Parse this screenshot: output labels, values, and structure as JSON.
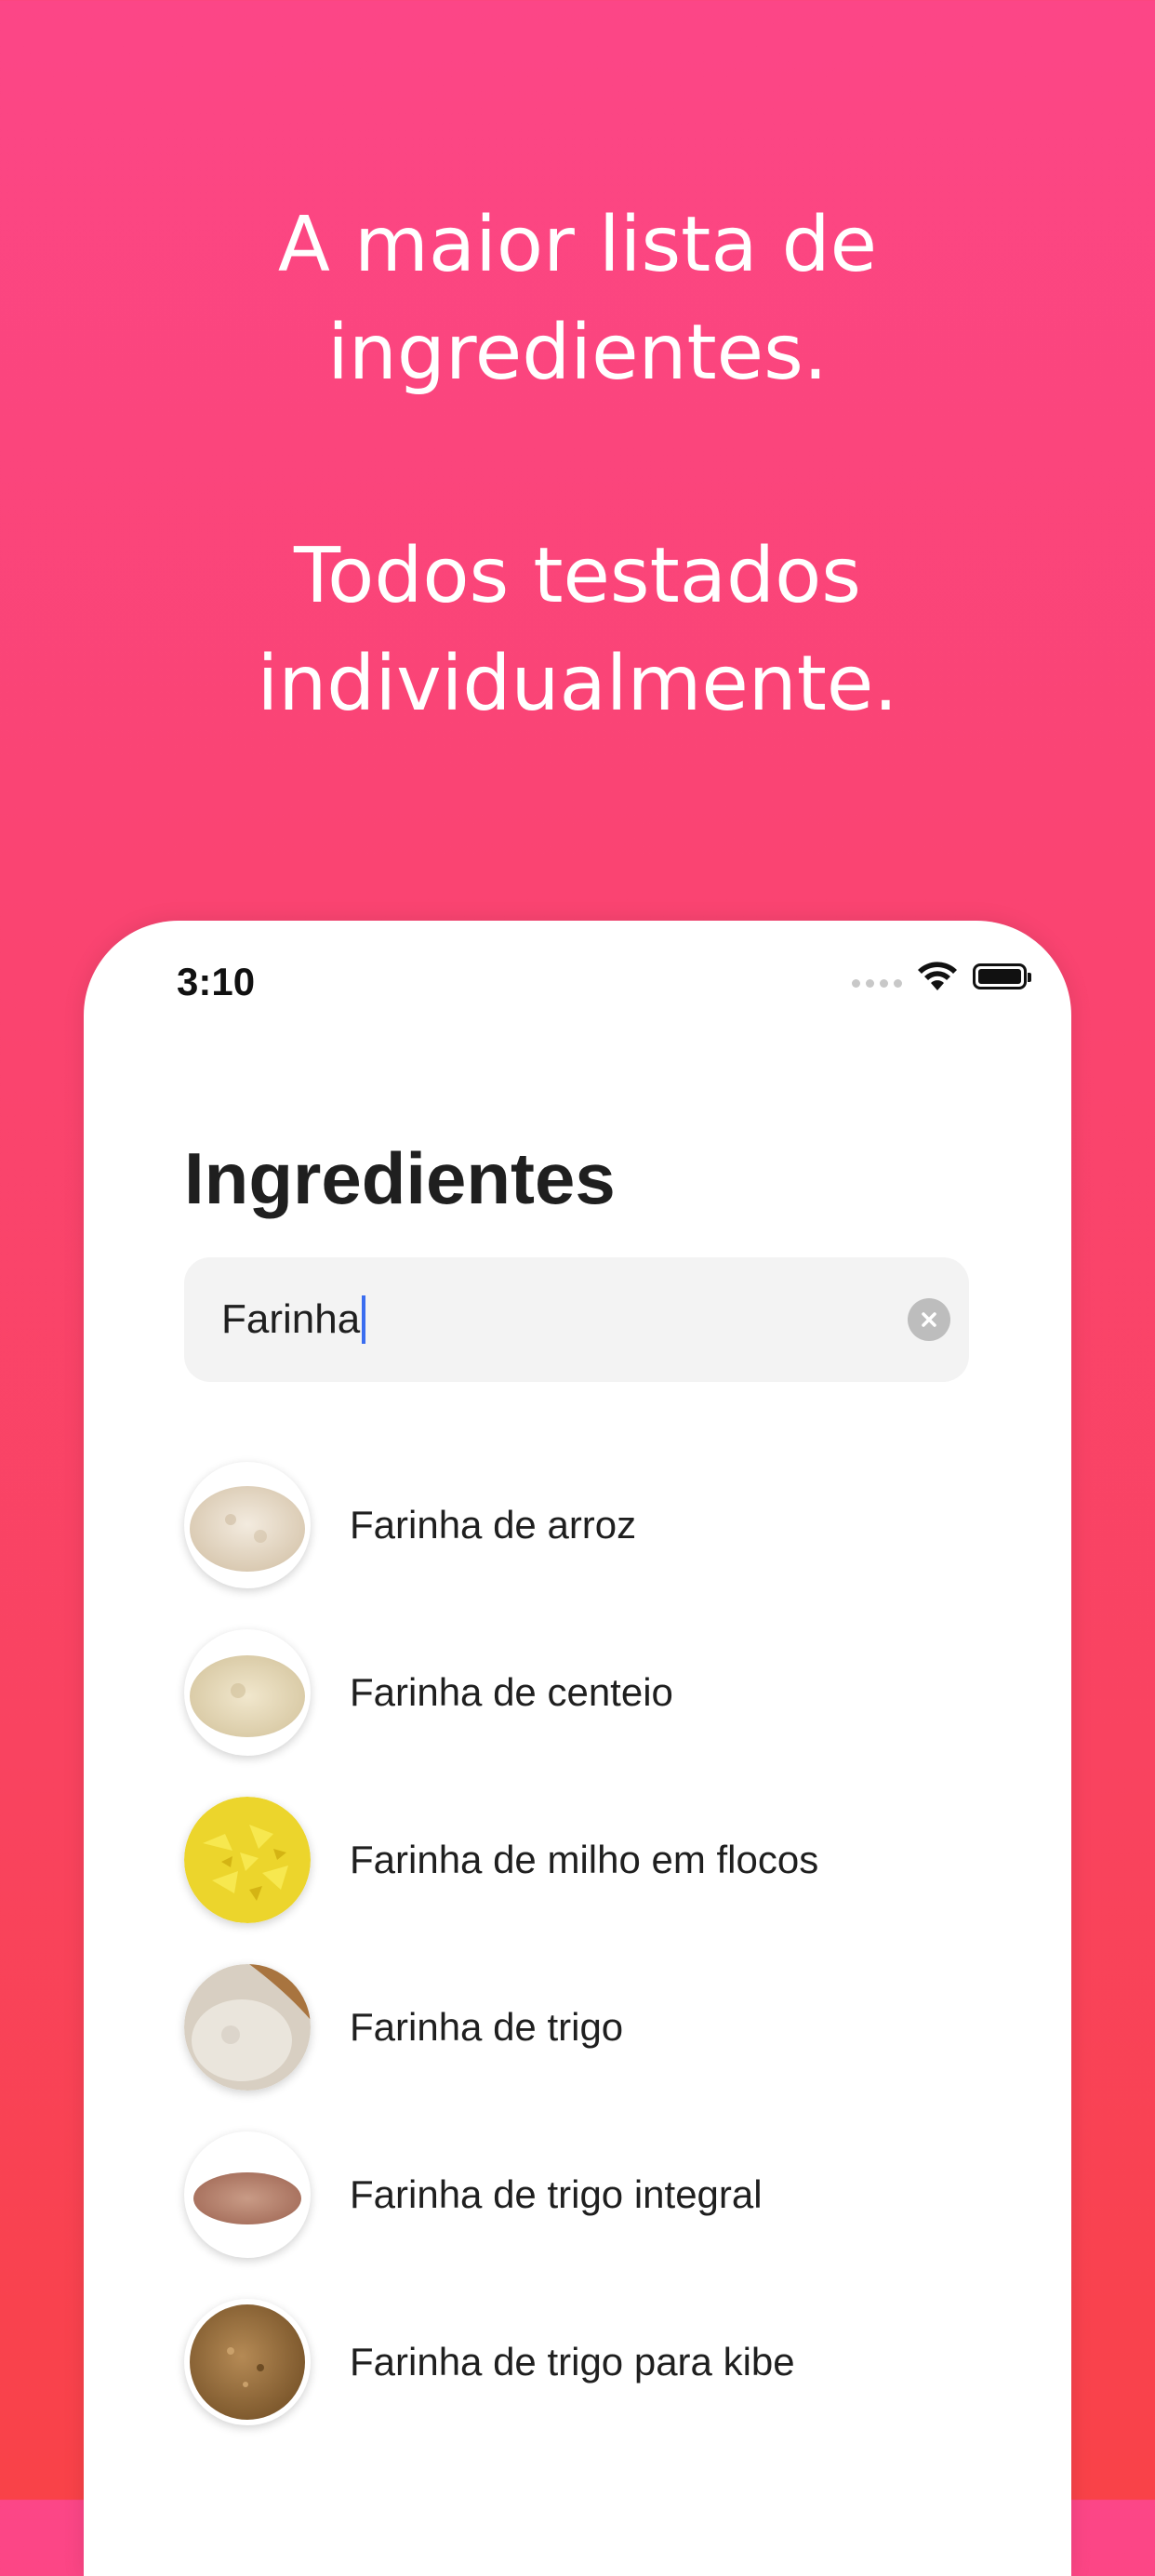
{
  "headline": {
    "line1": "A maior lista de",
    "line2": "ingredientes.",
    "line3": "Todos testados",
    "line4": "individualmente."
  },
  "status_bar": {
    "time": "3:10",
    "icons": [
      "signal-dots-icon",
      "wifi-icon",
      "battery-icon"
    ]
  },
  "screen": {
    "title": "Ingredientes",
    "search": {
      "value": "Farinha",
      "clear_icon": "clear-circle-icon"
    },
    "ingredients": [
      {
        "label": "Farinha de arroz",
        "image": "rice-flour-image"
      },
      {
        "label": "Farinha de centeio",
        "image": "rye-flour-image"
      },
      {
        "label": "Farinha de milho em flocos",
        "image": "corn-flakes-flour-image"
      },
      {
        "label": "Farinha de trigo",
        "image": "wheat-flour-image"
      },
      {
        "label": "Farinha de trigo integral",
        "image": "whole-wheat-flour-image"
      },
      {
        "label": "Farinha de trigo para kibe",
        "image": "bulgur-wheat-image"
      }
    ]
  },
  "colors": {
    "background_top": "#fc4687",
    "background_bottom": "#f94248",
    "caret": "#3a6df0"
  }
}
